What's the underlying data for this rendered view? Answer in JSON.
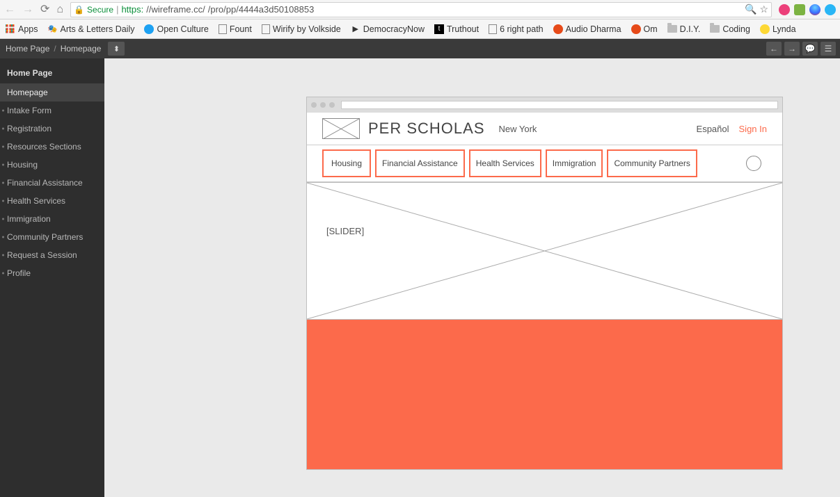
{
  "browser": {
    "secure_label": "Secure",
    "url_scheme": "https:",
    "url_host": "//wireframe.cc/",
    "url_path": "/pro/pp/4444a3d50108853"
  },
  "bookmarks": {
    "apps": "Apps",
    "items": [
      "Arts & Letters Daily",
      "Open Culture",
      "Fount",
      "Wirify by Volkside",
      "DemocracyNow",
      "Truthout",
      "6 right path",
      "Audio Dharma",
      "Om",
      "D.I.Y.",
      "Coding",
      "Lynda"
    ]
  },
  "appbar": {
    "crumb1": "Home Page",
    "crumb2": "Homepage",
    "cc": "cc"
  },
  "sidebar": {
    "title": "Home Page",
    "items": [
      "Homepage",
      "Intake Form",
      "Registration",
      "Resources Sections",
      "Housing",
      "Financial Assistance",
      "Health Services",
      "Immigration",
      "Community Partners",
      "Request a Session",
      "Profile"
    ]
  },
  "wire": {
    "brand": "PER SCHOLAS",
    "location": "New York",
    "lang": "Español",
    "signin": "Sign In",
    "nav": [
      "Housing",
      "Financial Assistance",
      "Health Services",
      "Immigration",
      "Community Partners"
    ],
    "slider_label": "[SLIDER]"
  }
}
